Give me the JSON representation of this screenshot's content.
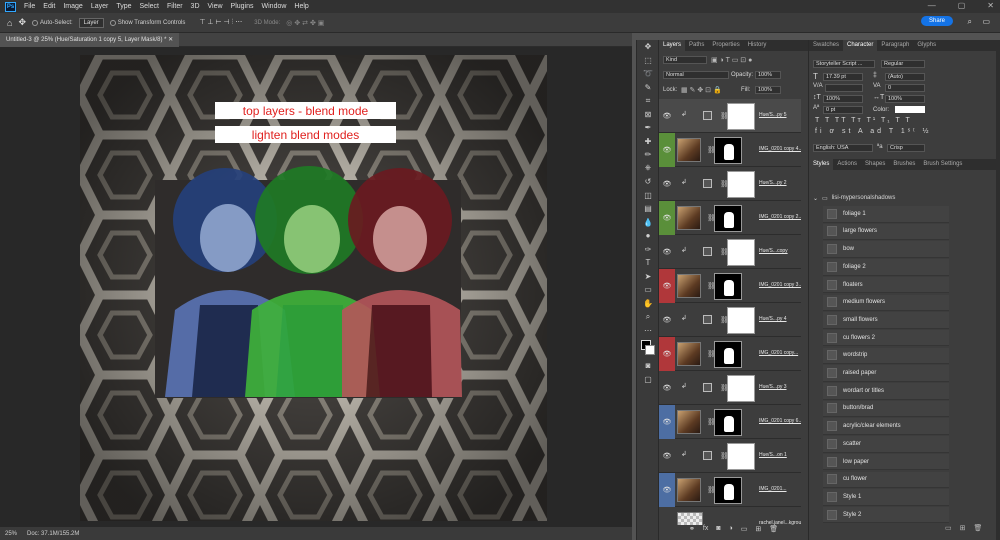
{
  "app": {
    "logo": "Ps"
  },
  "menu": [
    "File",
    "Edit",
    "Image",
    "Layer",
    "Type",
    "Select",
    "Filter",
    "3D",
    "View",
    "Plugins",
    "Window",
    "Help"
  ],
  "window_controls": [
    "—",
    "▢",
    "✕"
  ],
  "options": {
    "auto_select_label": "Auto-Select:",
    "auto_select_value": "Layer",
    "transform_label": "Show Transform Controls",
    "mode_3d": "3D Mode:",
    "share_label": "Share"
  },
  "document": {
    "tab_title": "Untitled-3 @ 25% (Hue/Saturation 1 copy 5, Layer Mask/8) *",
    "callout_1": "top layers - blend mode",
    "callout_2": "lighten blend modes",
    "callout_color": "#e0211f"
  },
  "status": {
    "zoom": "25%",
    "doc": "Doc: 37.1M/155.2M"
  },
  "layers_panel": {
    "tabs": [
      "Layers",
      "Paths",
      "Properties",
      "History"
    ],
    "filter": "Kind",
    "blend_mode": "Normal",
    "opacity_label": "Opacity:",
    "opacity": "100%",
    "lock_label": "Lock:",
    "fill_label": "Fill:",
    "fill": "100%",
    "layers": [
      {
        "name": "Hue/S...py 5",
        "type": "adj",
        "color": ""
      },
      {
        "name": "IMG_0201 copy 4...",
        "type": "photo",
        "color": "#5a8f3a"
      },
      {
        "name": "Hue/S...py 2",
        "type": "adj",
        "color": ""
      },
      {
        "name": "IMG_0201 copy 2...",
        "type": "photo",
        "color": "#5a8f3a"
      },
      {
        "name": "Hue/S...copy",
        "type": "adj",
        "color": ""
      },
      {
        "name": "IMG_0201 copy 3...",
        "type": "photo",
        "color": "#b0373a"
      },
      {
        "name": "Hue/S...py 4",
        "type": "adj",
        "color": ""
      },
      {
        "name": "IMG_0201 copy...",
        "type": "photo",
        "color": "#b0373a"
      },
      {
        "name": "Hue/S...py 3",
        "type": "adj",
        "color": ""
      },
      {
        "name": "IMG_0201 copy 6...",
        "type": "photo",
        "color": "#4d6ea3"
      },
      {
        "name": "Hue/S...on 1",
        "type": "adj",
        "color": ""
      },
      {
        "name": "IMG_0201...",
        "type": "photo",
        "color": "#4d6ea3"
      },
      {
        "name": "rachel.janel...kground...2",
        "type": "paper",
        "color": ""
      }
    ],
    "footer_icons": [
      "link-icon",
      "fx-icon",
      "mask-icon",
      "adjust-icon",
      "folder-icon",
      "new-icon",
      "trash-icon"
    ]
  },
  "right_panel": {
    "top_tabs": [
      "Swatches",
      "Character",
      "Paragraph",
      "Glyphs"
    ],
    "font_family": "Storyteller Script ...",
    "font_style": "Regular",
    "font_size": "17.39 pt",
    "leading": "(Auto)",
    "kerning": "",
    "tracking": "0",
    "vscale": "100%",
    "hscale": "100%",
    "baseline": "0 pt",
    "color_label": "Color:",
    "language": "English: USA",
    "antialias": "Crisp",
    "styles_tabs": [
      "Styles",
      "Actions",
      "Shapes",
      "Brushes",
      "Brush Settings"
    ],
    "group": "lisi-mypersonalshadows",
    "styles": [
      "foliage 1",
      "large flowers",
      "bow",
      "foliage 2",
      "floaters",
      "medium flowers",
      "small flowers",
      "cu flowers 2",
      "wordstrip",
      "raised paper",
      "wordart or titles",
      "button/brad",
      "acrylic/clear elements",
      "scatter",
      "low paper",
      "cu flower",
      "Style 1",
      "Style 2"
    ]
  }
}
